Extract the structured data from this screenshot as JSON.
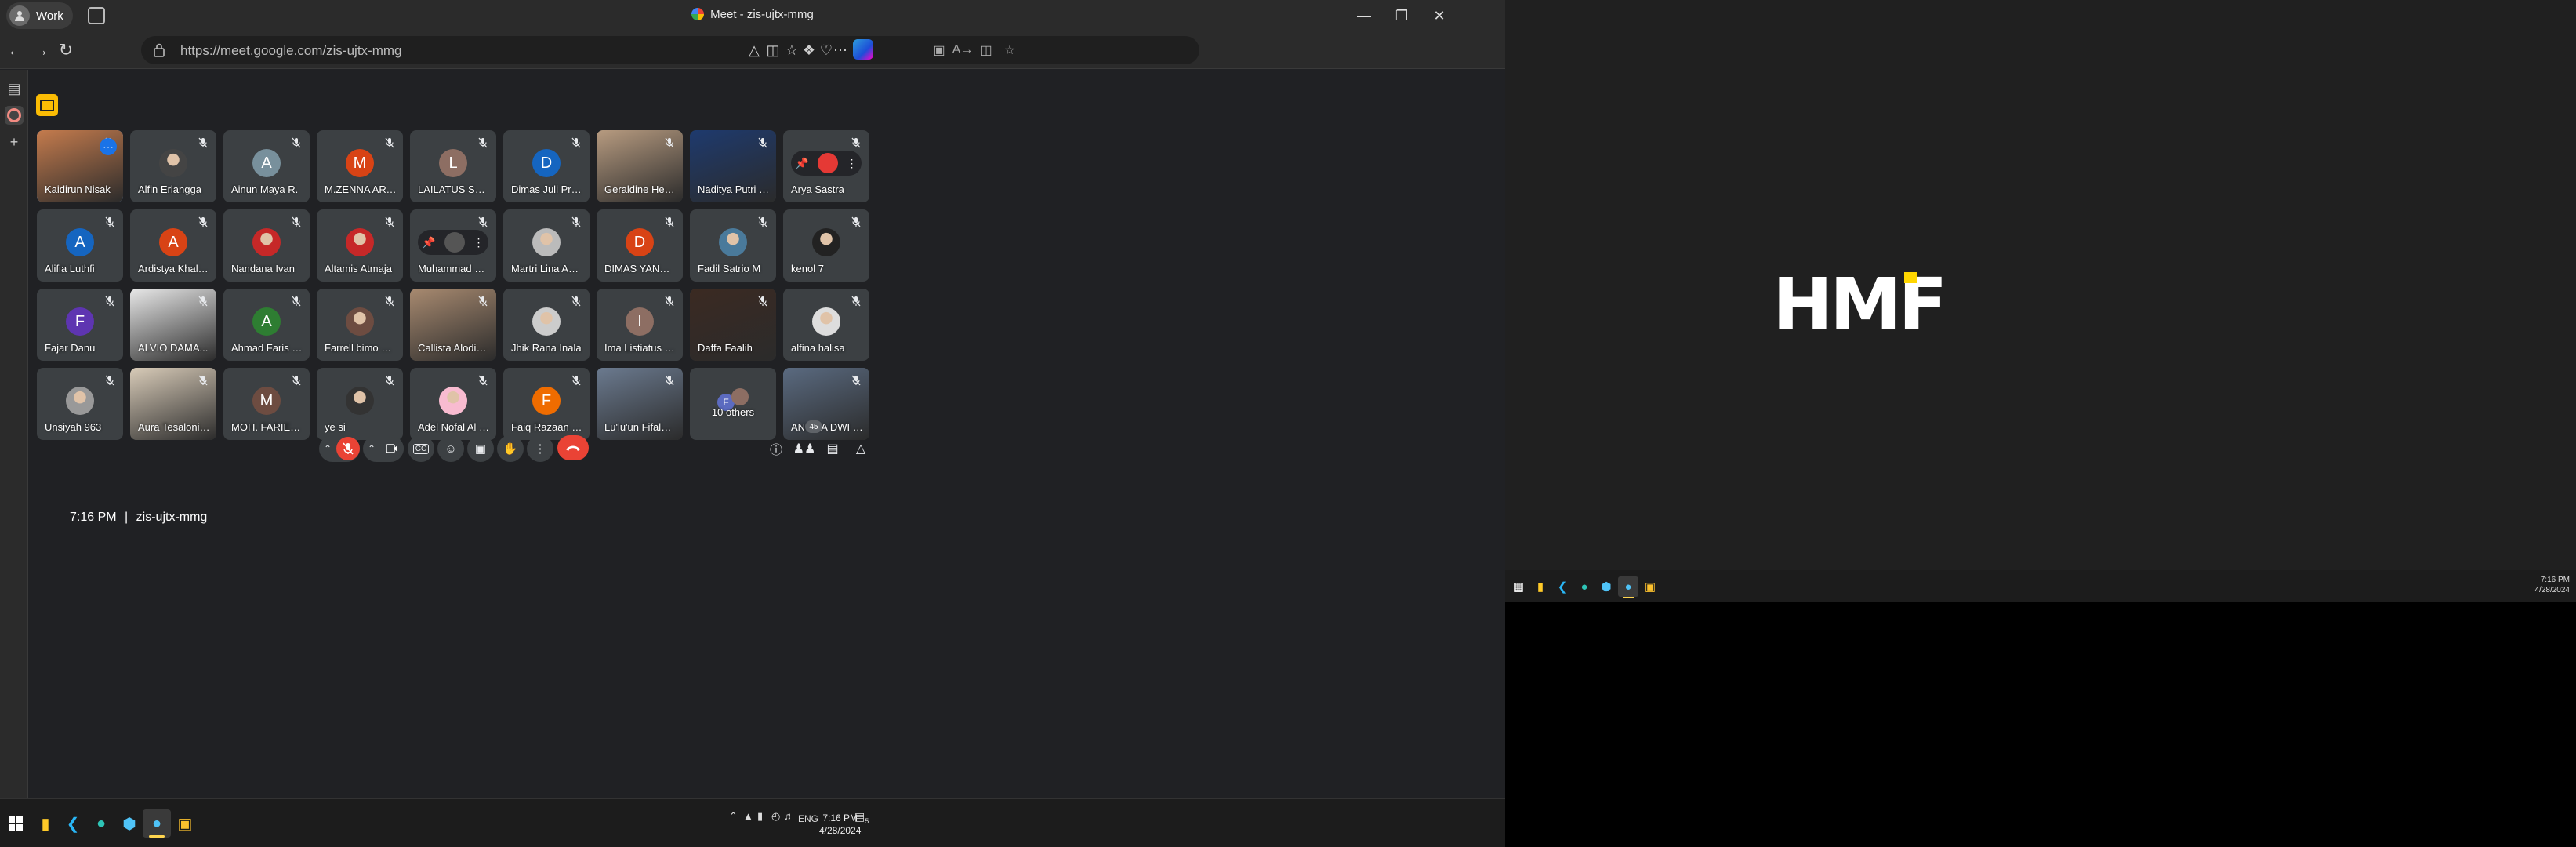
{
  "browser": {
    "profile_label": "Work",
    "window_title": "Meet - zis-ujtx-mmg",
    "url": "https://meet.google.com/zis-ujtx-mmg"
  },
  "meet": {
    "time": "7:16 PM",
    "separator": "|",
    "meeting_code": "zis-ujtx-mmg",
    "participant_count": "45",
    "participants": [
      {
        "name": "Kaidirun Nisak",
        "type": "video",
        "color": "#c47b4d",
        "active": true
      },
      {
        "name": "Alfin Erlangga",
        "type": "photo",
        "color": "#444"
      },
      {
        "name": "Ainun Maya R.",
        "type": "initial",
        "initial": "A",
        "color": "#78909c"
      },
      {
        "name": "M.ZENNA ARTA ...",
        "type": "initial",
        "initial": "M",
        "color": "#d84315"
      },
      {
        "name": "LAILATUS SYA'D...",
        "type": "initial",
        "initial": "L",
        "color": "#8d6e63"
      },
      {
        "name": "Dimas Juli Prata...",
        "type": "initial",
        "initial": "D",
        "color": "#1565c0"
      },
      {
        "name": "Geraldine Hend...",
        "type": "video",
        "color": "#b79b80"
      },
      {
        "name": "Naditya Putri Le...",
        "type": "video",
        "color": "#1e3a6e"
      },
      {
        "name": "Arya Sastra",
        "type": "hover",
        "color": "#e53935"
      },
      {
        "name": "Alifia Luthfi",
        "type": "initial",
        "initial": "A",
        "color": "#1565c0"
      },
      {
        "name": "Ardistya Khalfa...",
        "type": "initial",
        "initial": "A",
        "color": "#d84315"
      },
      {
        "name": "Nandana Ivan",
        "type": "photo",
        "color": "#c62828"
      },
      {
        "name": "Altamis Atmaja",
        "type": "photo",
        "color": "#c62828"
      },
      {
        "name": "Muhammad dza...",
        "type": "hover",
        "color": "#555"
      },
      {
        "name": "Martri Lina Ang...",
        "type": "photo",
        "color": "#bbb"
      },
      {
        "name": "DIMAS YANUAR ...",
        "type": "initial",
        "initial": "D",
        "color": "#d84315"
      },
      {
        "name": "Fadil Satrio M",
        "type": "photo",
        "color": "#4a7a9b"
      },
      {
        "name": "kenol 7",
        "type": "photo",
        "color": "#222"
      },
      {
        "name": "Fajar Danu",
        "type": "initial",
        "initial": "F",
        "color": "#5e35b1"
      },
      {
        "name": "ALVIO DAMA...",
        "type": "video",
        "color": "#e8e8e8"
      },
      {
        "name": "Ahmad Faris Dh...",
        "type": "initial",
        "initial": "A",
        "color": "#2e7d32"
      },
      {
        "name": "Farrell bimo Seno",
        "type": "photo",
        "color": "#6d4c41"
      },
      {
        "name": "Callista Alodia ...",
        "type": "video",
        "color": "#a88a70"
      },
      {
        "name": "Jhik Rana Inala",
        "type": "photo",
        "color": "#ccc"
      },
      {
        "name": "Ima Listiatus Sa'...",
        "type": "initial",
        "initial": "I",
        "color": "#8d6e63"
      },
      {
        "name": "Daffa Faalih",
        "type": "video",
        "color": "#3b2a22"
      },
      {
        "name": "alfina halisa",
        "type": "photo",
        "color": "#ddd"
      },
      {
        "name": "Unsiyah 963",
        "type": "photo",
        "color": "#999"
      },
      {
        "name": "Aura Tesalonika...",
        "type": "video",
        "color": "#d8cbb8"
      },
      {
        "name": "MOH. FARIED A...",
        "type": "initial",
        "initial": "M",
        "color": "#6d4c41"
      },
      {
        "name": "ye si",
        "type": "photo",
        "color": "#333"
      },
      {
        "name": "Adel Nofal Al far...",
        "type": "photo",
        "color": "#f8bbd0"
      },
      {
        "name": "Faiq Razaan Nur...",
        "type": "initial",
        "initial": "F",
        "color": "#ef6c00"
      },
      {
        "name": "Lu'lu'un Fifalaqisa",
        "type": "video",
        "color": "#6b7a8f"
      },
      {
        "name": "10 others",
        "type": "others"
      },
      {
        "name": "ANGGA DWI KU...",
        "type": "video",
        "color": "#5a6a80"
      }
    ]
  },
  "taskbar": {
    "time": "7:16 PM",
    "date": "4/28/2024",
    "language": "ENG",
    "notif_count": "5"
  },
  "second_monitor": {
    "logo_text": "HMF",
    "time": "7:16 PM",
    "date": "4/28/2024"
  }
}
